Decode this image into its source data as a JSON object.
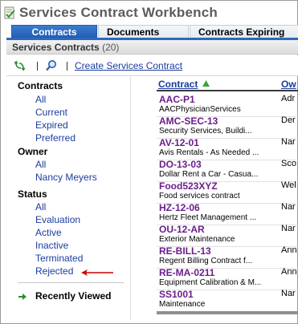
{
  "title": "Services Contract Workbench",
  "tabs": [
    {
      "label": "Contracts",
      "active": true
    },
    {
      "label": "Documents",
      "active": false
    },
    {
      "label": "Contracts Expiring",
      "active": false
    }
  ],
  "section": {
    "title": "Services Contracts",
    "count": "(20)"
  },
  "toolbar": {
    "sync_icon": "sync-arrows-icon",
    "search_icon": "search-icon",
    "create_label": "Create Services Contract"
  },
  "filters": {
    "contracts_heading": "Contracts",
    "contracts": [
      "All",
      "Current",
      "Expired",
      "Preferred"
    ],
    "owner_heading": "Owner",
    "owner": [
      "All",
      "Nancy Meyers"
    ],
    "status_heading": "Status",
    "status": [
      "All",
      "Evaluation",
      "Active",
      "Inactive",
      "Terminated",
      "Rejected"
    ],
    "recently_viewed": "Recently Viewed"
  },
  "list": {
    "col_contract": "Contract",
    "col_owner": "Ow",
    "rows": [
      {
        "id": "AAC-P1",
        "desc": "AACPhysicianServices",
        "owner": "Adr"
      },
      {
        "id": "AMC-SEC-13",
        "desc": "Security Services, Buildi...",
        "owner": "Der"
      },
      {
        "id": "AV-12-01",
        "desc": "Avis Rentals - As Needed ...",
        "owner": "Nar"
      },
      {
        "id": "DO-13-03",
        "desc": "Dollar Rent a Car - Casua...",
        "owner": "Sco"
      },
      {
        "id": "Food523XYZ",
        "desc": "Food services contract",
        "owner": "Wel"
      },
      {
        "id": "HZ-12-06",
        "desc": "Hertz Fleet Management ...",
        "owner": "Nar"
      },
      {
        "id": "OU-12-AR",
        "desc": "Exterior Maintenance",
        "owner": "Nar"
      },
      {
        "id": "RE-BILL-13",
        "desc": "Regent Billing Contract f...",
        "owner": "Ann"
      },
      {
        "id": "RE-MA-0211",
        "desc": "Equipment Calibration & M...",
        "owner": "Ann"
      },
      {
        "id": "SS1001",
        "desc": "Maintenance",
        "owner": "Nar"
      }
    ]
  },
  "colors": {
    "tab_active": "#2d69bd",
    "link": "#1a3c9e",
    "contract_id": "#6b1d8a",
    "annotation_arrow": "#cc0000",
    "recent_arrow": "#2e8b2e"
  }
}
